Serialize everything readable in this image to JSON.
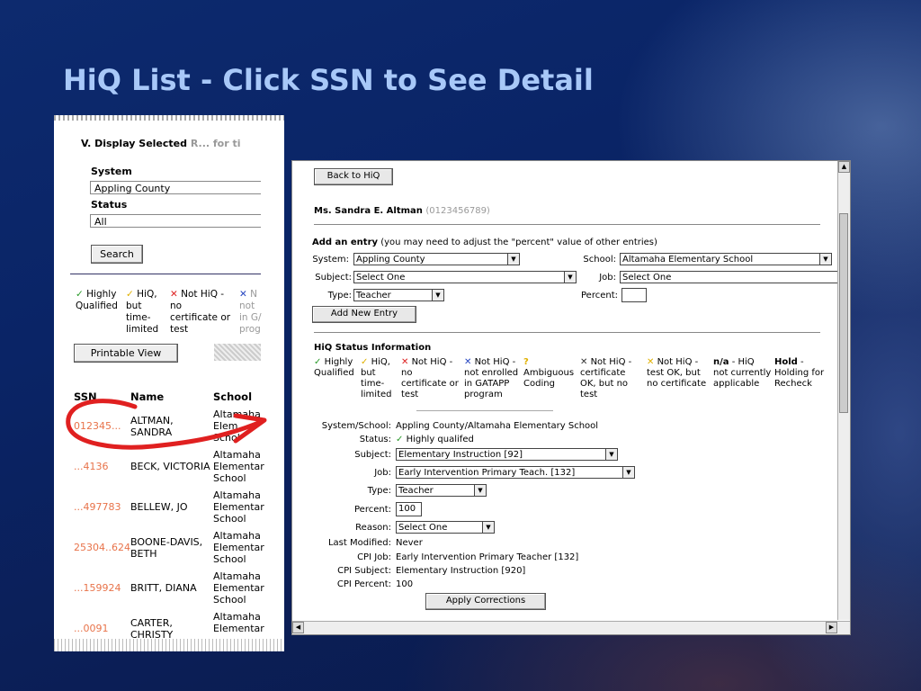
{
  "slide": {
    "title": "HiQ List - Click SSN to See Detail"
  },
  "colors": {
    "title": "#a8c8f8",
    "ssn_link": "#e8734a",
    "annotation": "#e02020"
  },
  "left_panel": {
    "section_title": "V. Display Selected",
    "section_title_faded": "R... for ti",
    "system_label": "System",
    "system_value": "Appling County",
    "status_label": "Status",
    "status_value": "All",
    "search_button": "Search",
    "legend": [
      {
        "icon": "check",
        "text1": "Highly",
        "text2": "Qualified",
        "text3": "",
        "text4": ""
      },
      {
        "icon": "check-yellow",
        "text1": "HiQ,",
        "text2": "but",
        "text3": "time-",
        "text4": "limited"
      },
      {
        "icon": "x-red",
        "text1": "Not HiQ -",
        "text2": "no",
        "text3": "certificate or",
        "text4": "test"
      },
      {
        "icon": "x-blue",
        "text1": "N",
        "text2": "not",
        "text3": "in G/",
        "text4": "prog"
      }
    ],
    "printable_button": "Printable View",
    "table_headers": {
      "ssn": "SSN",
      "name": "Name",
      "school": "School"
    },
    "rows": [
      {
        "ssn": "012345...",
        "name1": "ALTMAN,",
        "name2": "SANDRA",
        "school1": "Altamaha",
        "school2": "Elem",
        "school3": "Schol"
      },
      {
        "ssn": "...4136",
        "name1": "BECK, VICTORIA",
        "name2": "",
        "school1": "Altamaha",
        "school2": "Elementar",
        "school3": "School"
      },
      {
        "ssn": "...497783",
        "name1": "BELLEW, JO",
        "name2": "",
        "school1": "Altamaha",
        "school2": "Elementar",
        "school3": "School"
      },
      {
        "ssn": "25304..624",
        "name1": "BOONE-DAVIS,",
        "name2": "BETH",
        "school1": "Altamaha",
        "school2": "Elementar",
        "school3": "School"
      },
      {
        "ssn": "...159924",
        "name1": "BRITT, DIANA",
        "name2": "",
        "school1": "Altamaha",
        "school2": "Elementar",
        "school3": "School"
      },
      {
        "ssn": "...0091",
        "name1": "CARTER,",
        "name2": "CHRISTY",
        "school1": "Altamaha",
        "school2": "Elementar",
        "school3": ""
      }
    ]
  },
  "right_panel": {
    "back_button": "Back to HiQ",
    "person_name": "Ms. Sandra E. Altman",
    "person_id": "(0123456789)",
    "add_entry_heading": "Add an entry",
    "add_entry_note": "(you may need to adjust the \"percent\" value of other entries)",
    "system_label": "System:",
    "system_value": "Appling County",
    "school_label": "School:",
    "school_value": "Altamaha Elementary School",
    "subject_label": "Subject:",
    "subject_value": "Select One",
    "job_label": "Job:",
    "job_value": "Select One",
    "type_label": "Type:",
    "type_value": "Teacher",
    "percent_label": "Percent:",
    "percent_value": "",
    "add_button": "Add New Entry",
    "hiq_heading": "HiQ Status Information",
    "legend": [
      {
        "sym": "✓",
        "cls": "green",
        "lines": [
          "Highly",
          "Qualified"
        ]
      },
      {
        "sym": "✓",
        "cls": "yel",
        "lines": [
          "HiQ,",
          "but",
          "time-",
          "limited"
        ]
      },
      {
        "sym": "✕",
        "cls": "red",
        "lines": [
          "Not HiQ -",
          "no",
          "certificate or",
          "test"
        ]
      },
      {
        "sym": "✕",
        "cls": "blue",
        "lines": [
          "Not HiQ -",
          "not enrolled",
          "in GATAPP",
          "program"
        ]
      },
      {
        "sym": "?",
        "cls": "yel",
        "lines": [
          "Ambiguous",
          "Coding"
        ]
      },
      {
        "sym": "✕",
        "cls": "dk",
        "lines": [
          "Not HiQ -",
          "certificate",
          "OK, but no",
          "test"
        ]
      },
      {
        "sym": "✕",
        "cls": "yel",
        "lines": [
          "Not HiQ -",
          "test OK, but",
          "no certificate"
        ]
      },
      {
        "sym": "n/a",
        "cls": "bold",
        "lines": [
          "- HiQ",
          "not currently",
          "applicable"
        ]
      },
      {
        "sym": "Hold",
        "cls": "bold",
        "lines": [
          "-",
          "Holding for",
          "Recheck"
        ]
      }
    ],
    "detail": {
      "system_school_label": "System/School:",
      "system_school_value": "Appling County/Altamaha Elementary School",
      "status_label": "Status:",
      "status_value": "Highly qualifed",
      "subject_label": "Subject:",
      "subject_value": "Elementary Instruction [92]",
      "job_label": "Job:",
      "job_value": "Early Intervention Primary Teach. [132]",
      "type_label": "Type:",
      "type_value": "Teacher",
      "percent_label": "Percent:",
      "percent_value": "100",
      "reason_label": "Reason:",
      "reason_value": "Select One",
      "last_modified_label": "Last Modified:",
      "last_modified_value": "Never",
      "cpi_job_label": "CPI Job:",
      "cpi_job_value": "Early Intervention Primary Teacher [132]",
      "cpi_subject_label": "CPI Subject:",
      "cpi_subject_value": "Elementary Instruction [920]",
      "cpi_percent_label": "CPI Percent:",
      "cpi_percent_value": "100"
    },
    "apply_button": "Apply Corrections"
  }
}
